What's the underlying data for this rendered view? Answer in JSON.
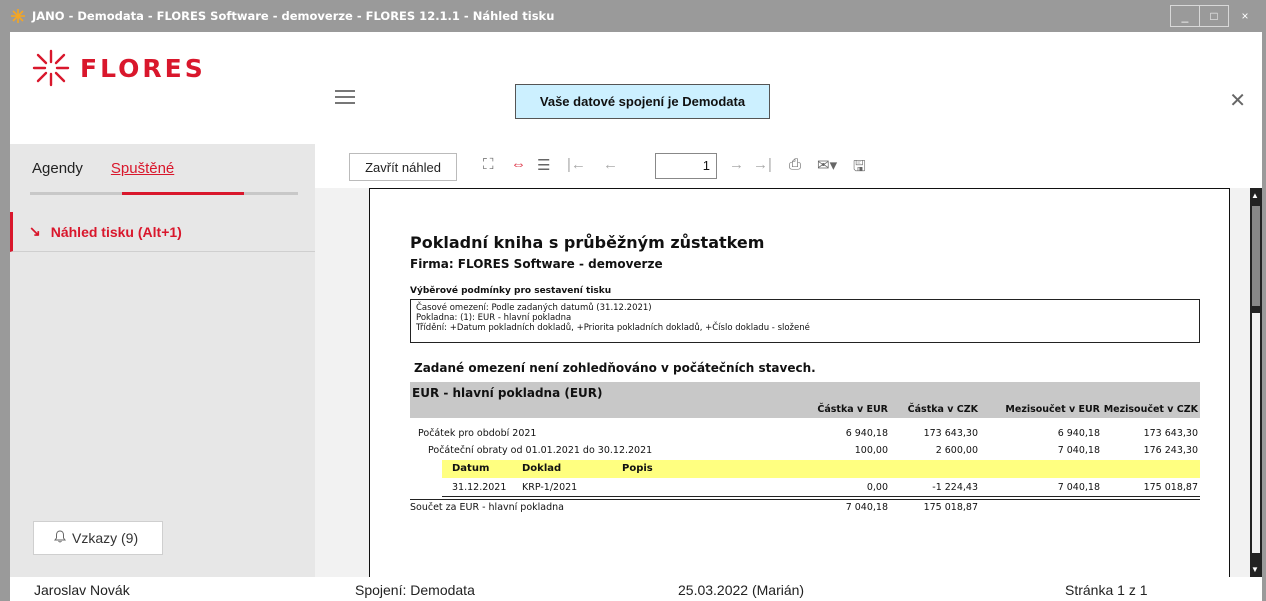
{
  "window": {
    "title": "JANO - Demodata - FLORES Software - demoverze - FLORES 12.1.1 - Náhled tisku",
    "minimize": "_",
    "maximize": "□",
    "close": "×"
  },
  "header": {
    "logo_text": "FLORES",
    "connection_banner": "Vaše datové spojení je Demodata",
    "close_symbol": "✕"
  },
  "sidebar": {
    "tabs": [
      "Agendy",
      "Spuštěné"
    ],
    "active_tab": "Spuštěné",
    "item": {
      "arrow": "↘",
      "label": "Náhled tisku (Alt+1)"
    },
    "alerts_button": "Vzkazy (9)"
  },
  "toolbar": {
    "close_preview": "Zavřít náhled",
    "page_value": "1",
    "icons": [
      "fit-page-icon",
      "fit-width-icon",
      "page-view-icon",
      "first-page-icon",
      "prev-page-icon",
      "next-page-icon",
      "last-page-icon",
      "print-icon",
      "email-icon",
      "save-icon"
    ]
  },
  "report": {
    "title": "Pokladní kniha s průběžným zůstatkem",
    "firm": "Firma: FLORES Software - demoverze",
    "conditions_label": "Výběrové podmínky pro sestavení tisku",
    "conditions": [
      "Časové omezení: Podle zadaných datumů (31.12.2021)",
      "Pokladna: (1): EUR - hlavní pokladna",
      "Třídění: +Datum pokladních dokladů, +Priorita pokladních dokladů, +Číslo dokladu - složené"
    ],
    "warning": "Zadané omezení není zohledňováno v počátečních stavech.",
    "section_title": "EUR - hlavní pokladna (EUR)",
    "columns": [
      "Částka v EUR",
      "Částka v CZK",
      "Mezisoučet v EUR",
      "Mezisoučet v CZK"
    ],
    "rows": [
      {
        "label": "Počátek pro období 2021",
        "values": [
          "6 940,18",
          "173 643,30",
          "6 940,18",
          "173 643,30"
        ]
      },
      {
        "label": "Počáteční obraty od 01.01.2021 do 30.12.2021",
        "values": [
          "100,00",
          "2 600,00",
          "7 040,18",
          "176 243,30"
        ]
      }
    ],
    "detail_headers": [
      "Datum",
      "Doklad",
      "Popis"
    ],
    "detail_row": {
      "date": "31.12.2021",
      "doc": "KRP-1/2021",
      "desc": "",
      "values": [
        "0,00",
        "-1 224,43",
        "7 040,18",
        "175 018,87"
      ]
    },
    "total": {
      "label": "Součet za EUR - hlavní pokladna",
      "values": [
        "7 040,18",
        "175 018,87"
      ]
    }
  },
  "statusbar": {
    "user": "Jaroslav Novák",
    "connection": "Spojení: Demodata",
    "date": "25.03.2022 (Marián)",
    "page": "Stránka 1 z 1"
  },
  "colors": {
    "brand": "#d9172c",
    "banner": "#ccf0ff",
    "highlight": "#ffff80"
  }
}
